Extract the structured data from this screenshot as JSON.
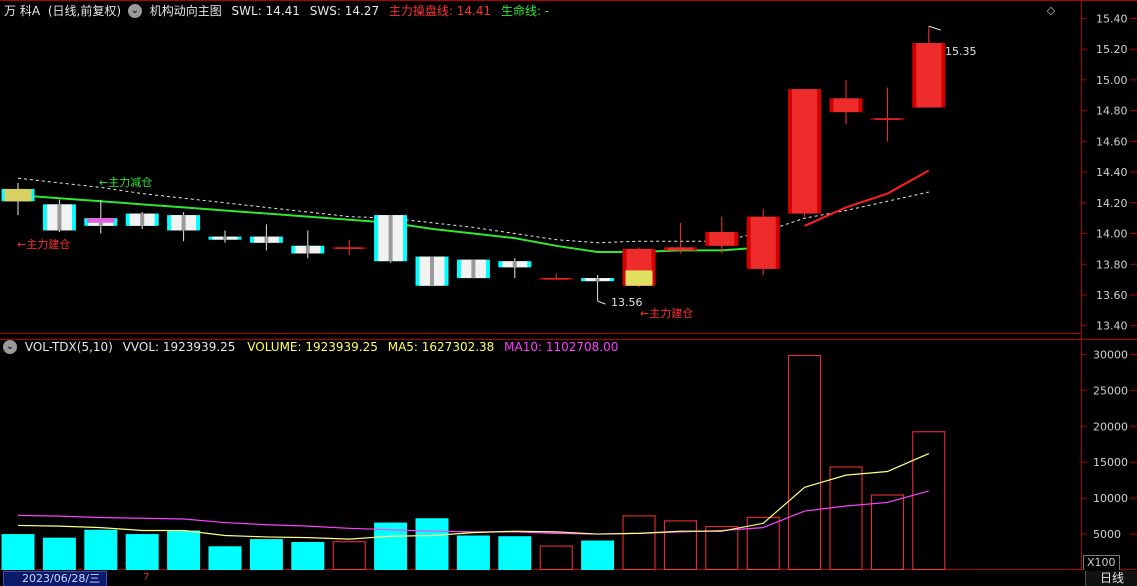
{
  "header": {
    "stock_name": "万 科A",
    "period_mode": "(日线,前复权)",
    "indicator_name": "机构动向主图",
    "swl_label": "SWL: 14.41",
    "sws_label": "SWS: 14.27",
    "main_line_label": "主力操盘线: 14.41",
    "life_line_label": "生命线: -"
  },
  "volume_header": {
    "indicator": "VOL-TDX(5,10)",
    "vvol": "VVOL: 1923939.25",
    "volume": "VOLUME: 1923939.25",
    "ma5": "MA5: 1627302.38",
    "ma10": "MA10: 1102708.00"
  },
  "price_axis_labels": [
    "15.40",
    "15.20",
    "15.00",
    "14.80",
    "14.60",
    "14.40",
    "14.20",
    "14.00",
    "13.80",
    "13.60",
    "13.40"
  ],
  "volume_axis_labels": [
    "30000",
    "25000",
    "20000",
    "15000",
    "10000",
    "5000"
  ],
  "volume_unit": "X100",
  "annotations": {
    "high_marker": "15.35",
    "low_marker": "13.56",
    "build_left": "←主力建仓",
    "reduce": "←主力减仓",
    "build_mid": "←主力建仓"
  },
  "footer": {
    "date": "2023/06/28/三",
    "month_mark": "7",
    "period_tab": "日线"
  },
  "colors": {
    "up": "#ff3232",
    "down": "#00ffff",
    "main_line": "#32e632",
    "red_line": "#ff2020",
    "ma5": "#ffff80",
    "ma10": "#ff40ff",
    "axis": "#b00000",
    "build_text": "#ff3030",
    "reduce_text": "#32e632"
  },
  "chart_data": {
    "type": "candlestick",
    "candles": [
      {
        "o": 14.29,
        "h": 14.33,
        "l": 14.12,
        "c": 14.21
      },
      {
        "o": 14.19,
        "h": 14.22,
        "l": 14.01,
        "c": 14.02
      },
      {
        "o": 14.1,
        "h": 14.22,
        "l": 14.0,
        "c": 14.05
      },
      {
        "o": 14.13,
        "h": 14.14,
        "l": 14.03,
        "c": 14.05
      },
      {
        "o": 14.12,
        "h": 14.14,
        "l": 13.95,
        "c": 14.02
      },
      {
        "o": 13.98,
        "h": 14.02,
        "l": 13.94,
        "c": 13.96
      },
      {
        "o": 13.98,
        "h": 14.06,
        "l": 13.89,
        "c": 13.94
      },
      {
        "o": 13.92,
        "h": 14.02,
        "l": 13.84,
        "c": 13.87
      },
      {
        "o": 13.91,
        "h": 13.96,
        "l": 13.86,
        "c": 13.91
      },
      {
        "o": 14.12,
        "h": 14.12,
        "l": 13.81,
        "c": 13.82
      },
      {
        "o": 13.85,
        "h": 13.85,
        "l": 13.66,
        "c": 13.66
      },
      {
        "o": 13.83,
        "h": 13.83,
        "l": 13.71,
        "c": 13.71
      },
      {
        "o": 13.82,
        "h": 13.84,
        "l": 13.71,
        "c": 13.78
      },
      {
        "o": 13.71,
        "h": 13.74,
        "l": 13.7,
        "c": 13.71
      },
      {
        "o": 13.71,
        "h": 13.73,
        "l": 13.56,
        "c": 13.69
      },
      {
        "o": 13.66,
        "h": 13.91,
        "l": 13.65,
        "c": 13.9
      },
      {
        "o": 13.89,
        "h": 14.07,
        "l": 13.87,
        "c": 13.91
      },
      {
        "o": 13.92,
        "h": 14.11,
        "l": 13.87,
        "c": 14.01
      },
      {
        "o": 13.77,
        "h": 14.16,
        "l": 13.73,
        "c": 14.11
      },
      {
        "o": 14.13,
        "h": 14.94,
        "l": 14.11,
        "c": 14.94
      },
      {
        "o": 14.79,
        "h": 15.0,
        "l": 14.71,
        "c": 14.88
      },
      {
        "o": 14.75,
        "h": 14.95,
        "l": 14.6,
        "c": 14.75
      },
      {
        "o": 14.82,
        "h": 15.35,
        "l": 14.82,
        "c": 15.24
      }
    ],
    "volume": [
      5000,
      4500,
      5600,
      5000,
      5500,
      3300,
      4300,
      3900,
      4000,
      6600,
      7200,
      4800,
      4700,
      3400,
      4100,
      7600,
      6900,
      6100,
      7400,
      29900,
      14400,
      10500,
      19300
    ],
    "ma5": [
      6200,
      6100,
      5900,
      5500,
      5500,
      4800,
      4600,
      4500,
      4300,
      4700,
      4800,
      5200,
      5400,
      5300,
      5000,
      5100,
      5400,
      5400,
      6500,
      11500,
      13200,
      13700,
      16200
    ],
    "ma10": [
      7600,
      7500,
      7300,
      7200,
      7100,
      6600,
      6300,
      6100,
      5800,
      5600,
      5400,
      5300,
      5300,
      5100,
      5000,
      5100,
      5300,
      5500,
      5900,
      8200,
      8900,
      9400,
      11000
    ],
    "main_line": [
      14.25,
      14.23,
      14.21,
      14.19,
      14.17,
      14.15,
      14.13,
      14.11,
      14.09,
      14.07,
      14.03,
      14.0,
      13.97,
      13.92,
      13.88,
      13.88,
      13.89,
      13.89,
      13.91
    ],
    "red_line": [
      14.05,
      14.17,
      14.26,
      14.41
    ],
    "dashed_line": [
      14.36,
      14.33,
      14.3,
      14.26,
      14.23,
      14.2,
      14.17,
      14.14,
      14.11,
      14.1,
      14.07,
      14.04,
      14.0,
      13.96,
      13.94,
      13.95,
      13.95,
      13.95,
      14.01,
      14.1,
      14.15,
      14.21,
      14.27
    ],
    "price_range": [
      13.32,
      15.52
    ],
    "volume_range": [
      0,
      32000
    ]
  }
}
